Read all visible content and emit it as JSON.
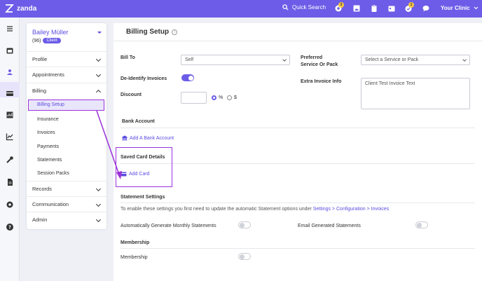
{
  "topbar": {
    "brand": "zanda",
    "search_label": "Quick Search",
    "badges": [
      "3",
      "1"
    ],
    "clinic_label": "Your Clinic",
    "colors": {
      "bar": "#6c5ce7",
      "badge": "#f4c542"
    }
  },
  "rail": {
    "icons": [
      "menu-icon",
      "calendar-icon",
      "clients-icon",
      "card-icon",
      "report-icon",
      "chart-icon",
      "wrench-icon",
      "document-icon",
      "gear-icon",
      "help-icon"
    ]
  },
  "client": {
    "name": "Bailey Müller",
    "id": "(96)",
    "badge": "Client"
  },
  "nav": {
    "items": [
      "Profile",
      "Appointments",
      "Billing",
      "Records",
      "Communication",
      "Admin"
    ],
    "billing_sub": [
      "Billing Setup",
      "Insurance",
      "Invoices",
      "Payments",
      "Statements",
      "Session Packs"
    ]
  },
  "main": {
    "title": "Billing Setup",
    "bill_to_label": "Bill To",
    "bill_to_value": "Self",
    "preferred_label_1": "Preferred",
    "preferred_label_2": "Service Or Pack",
    "preferred_placeholder": "Select a Service or Pack",
    "deidentify_label": "De-Identify Invoices",
    "deidentify_on": true,
    "extra_label": "Extra Invoice Info",
    "extra_value": "Client Test Invoice Text",
    "discount_label": "Discount",
    "discount_pct": "%",
    "discount_dollar": "$",
    "bank_section": "Bank Account",
    "add_bank": "Add A Bank Account",
    "saved_card_section": "Saved Card Details",
    "add_card": "Add Card",
    "statement_section": "Statement Settings",
    "statement_note_pre": "To enable these settings you first need to update the automatic Statement options under ",
    "statement_note_link": "Settings > Configuration > Invoices",
    "auto_monthly_label": "Automatically Generate Monthly Statements",
    "email_statements_label": "Email Generated Statements",
    "membership_section": "Membership",
    "membership_label": "Membership"
  }
}
